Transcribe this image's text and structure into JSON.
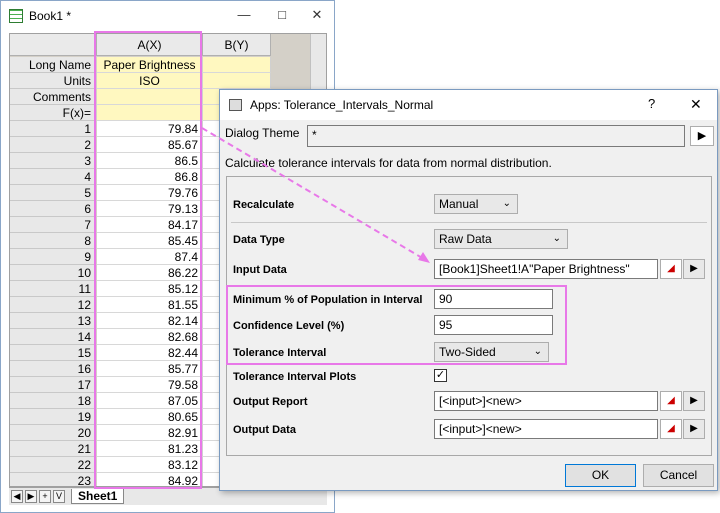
{
  "window": {
    "title": "Book1 *",
    "min": "—",
    "max": "□",
    "close": "✕"
  },
  "sheet": {
    "colA": "A(X)",
    "colB": "B(Y)",
    "labels": [
      "Long Name",
      "Units",
      "Comments",
      "F(x)="
    ],
    "longName": "Paper Brightness",
    "units": "ISO",
    "rows": [
      "79.84",
      "85.67",
      "86.5",
      "86.8",
      "79.76",
      "79.13",
      "84.17",
      "85.45",
      "87.4",
      "86.22",
      "85.12",
      "81.55",
      "82.14",
      "82.68",
      "82.44",
      "85.77",
      "79.58",
      "87.05",
      "80.65",
      "82.91",
      "81.23",
      "83.12",
      "84.92"
    ],
    "tabName": "Sheet1"
  },
  "dialog": {
    "title": "Apps: Tolerance_Intervals_Normal",
    "help": "?",
    "close": "✕",
    "themeLabel": "Dialog Theme",
    "themeValue": "*",
    "description": "Calculate tolerance intervals for data from normal distribution.",
    "recalculate": {
      "label": "Recalculate",
      "value": "Manual"
    },
    "dataType": {
      "label": "Data Type",
      "value": "Raw Data"
    },
    "inputData": {
      "label": "Input Data",
      "value": "[Book1]Sheet1!A\"Paper Brightness\""
    },
    "minPop": {
      "label": "Minimum % of Population in Interval",
      "value": "90"
    },
    "confidence": {
      "label": "Confidence Level (%)",
      "value": "95"
    },
    "tolInterval": {
      "label": "Tolerance Interval",
      "value": "Two-Sided"
    },
    "plots": {
      "label": "Tolerance Interval Plots",
      "checked": "✓"
    },
    "outReport": {
      "label": "Output Report",
      "value": "[<input>]<new>"
    },
    "outData": {
      "label": "Output Data",
      "value": "[<input>]<new>"
    },
    "ok": "OK",
    "cancel": "Cancel"
  },
  "colors": {
    "highlight": "#e878e8"
  }
}
